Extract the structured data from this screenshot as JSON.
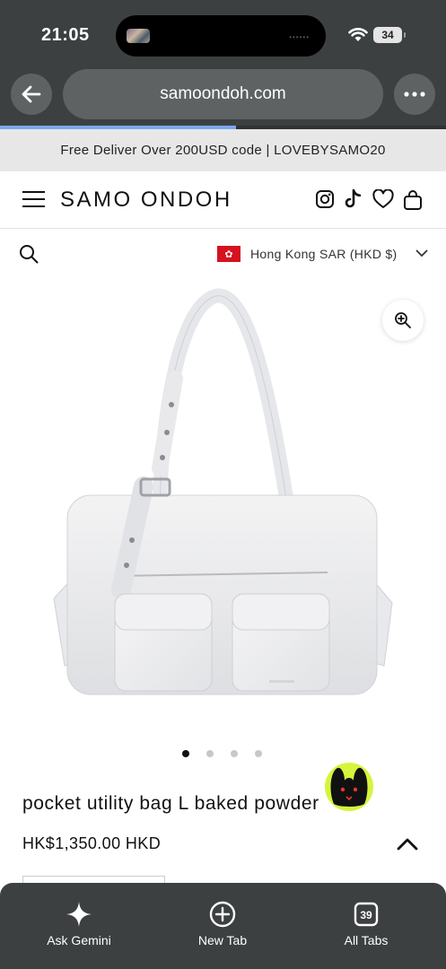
{
  "status_bar": {
    "time": "21:05",
    "battery": "34"
  },
  "browser": {
    "url": "samoondoh.com",
    "load_progress": 0.53,
    "back_icon": "back-arrow-icon",
    "menu_icon": "more-dots-icon"
  },
  "promo": {
    "text": "Free Deliver Over 200USD code | LOVEBYSAMO20"
  },
  "header": {
    "logo": "SAMO ONDOH",
    "icons": [
      "instagram-icon",
      "tiktok-icon",
      "heart-icon",
      "bag-icon"
    ]
  },
  "locale": {
    "region": "Hong Kong SAR (HKD $)",
    "flag": "hong-kong-flag-icon"
  },
  "product": {
    "title": "pocket utility bag L baked powder",
    "price": "HK$1,350.00 HKD",
    "image_count": 4,
    "active_image": 1
  },
  "toolbar": {
    "items": [
      {
        "label": "Ask Gemini",
        "icon": "sparkle-icon"
      },
      {
        "label": "New Tab",
        "icon": "plus-circle-icon"
      },
      {
        "label": "All Tabs",
        "icon": "tabs-count-icon",
        "count": "39"
      }
    ]
  },
  "colors": {
    "chrome": "#3d4040",
    "progress": "#7aa7ee",
    "promo_bg": "#e7e7e7",
    "flag_red": "#d5121f",
    "chat_accent": "#d4f53c"
  }
}
